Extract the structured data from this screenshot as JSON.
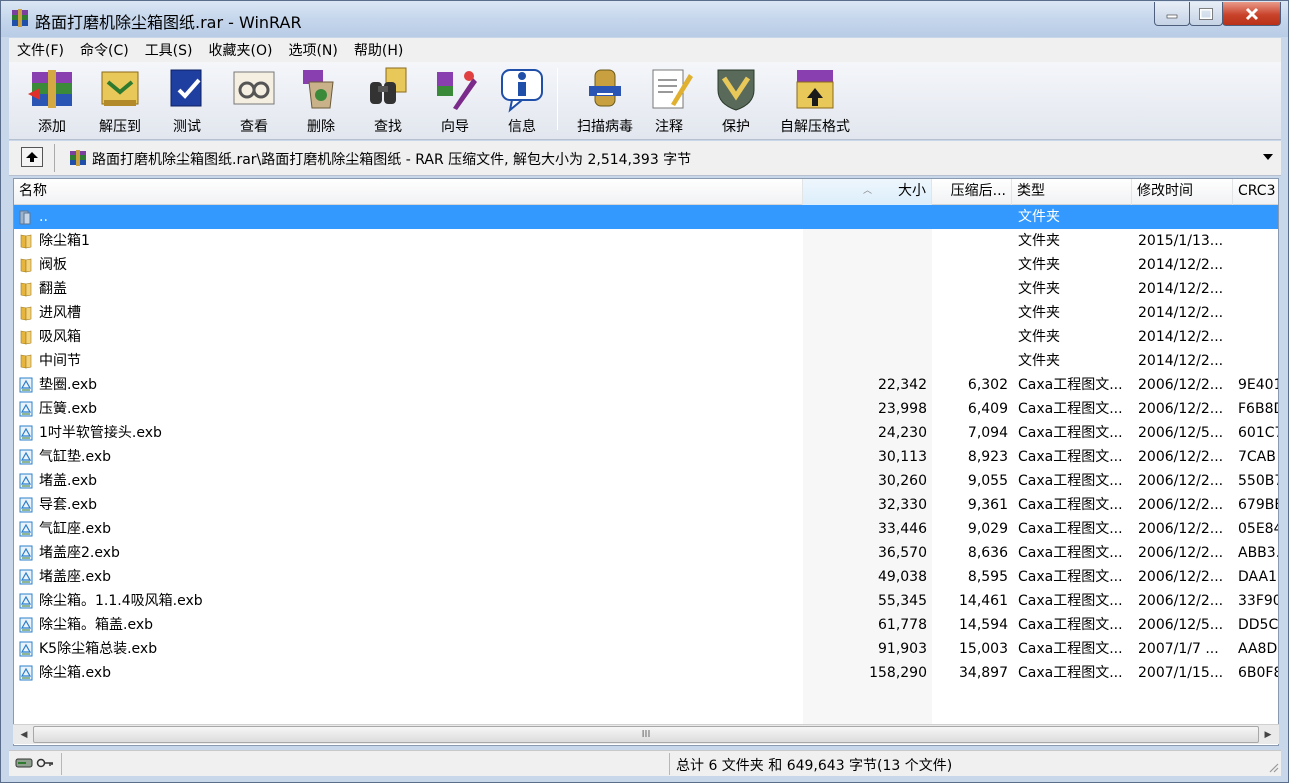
{
  "window": {
    "title": "路面打磨机除尘箱图纸.rar - WinRAR"
  },
  "menu": [
    "文件(F)",
    "命令(C)",
    "工具(S)",
    "收藏夹(O)",
    "选项(N)",
    "帮助(H)"
  ],
  "toolbar": [
    {
      "label": "添加",
      "icon": "add-archive-icon"
    },
    {
      "label": "解压到",
      "icon": "extract-to-icon"
    },
    {
      "label": "测试",
      "icon": "test-icon"
    },
    {
      "label": "查看",
      "icon": "view-icon"
    },
    {
      "label": "删除",
      "icon": "delete-icon"
    },
    {
      "label": "查找",
      "icon": "find-icon"
    },
    {
      "label": "向导",
      "icon": "wizard-icon"
    },
    {
      "label": "信息",
      "icon": "info-icon"
    },
    {
      "label": "扫描病毒",
      "icon": "virus-scan-icon"
    },
    {
      "label": "注释",
      "icon": "comment-icon"
    },
    {
      "label": "保护",
      "icon": "protect-icon"
    },
    {
      "label": "自解压格式",
      "icon": "sfx-icon"
    }
  ],
  "address": {
    "path": "路面打磨机除尘箱图纸.rar\\路面打磨机除尘箱图纸 - RAR 压缩文件, 解包大小为 2,514,393 字节"
  },
  "columns": {
    "name": "名称",
    "size": "大小",
    "packed": "压缩后...",
    "type": "类型",
    "mtime": "修改时间",
    "crc": "CRC3"
  },
  "files": [
    {
      "name": "..",
      "size": "",
      "packed": "",
      "type": "文件夹",
      "mtime": "",
      "crc": "",
      "kind": "parent",
      "selected": true
    },
    {
      "name": "除尘箱1",
      "size": "",
      "packed": "",
      "type": "文件夹",
      "mtime": "2015/1/13...",
      "crc": "",
      "kind": "folder"
    },
    {
      "name": "阀板",
      "size": "",
      "packed": "",
      "type": "文件夹",
      "mtime": "2014/12/2...",
      "crc": "",
      "kind": "folder"
    },
    {
      "name": "翻盖",
      "size": "",
      "packed": "",
      "type": "文件夹",
      "mtime": "2014/12/2...",
      "crc": "",
      "kind": "folder"
    },
    {
      "name": "进风槽",
      "size": "",
      "packed": "",
      "type": "文件夹",
      "mtime": "2014/12/2...",
      "crc": "",
      "kind": "folder"
    },
    {
      "name": "吸风箱",
      "size": "",
      "packed": "",
      "type": "文件夹",
      "mtime": "2014/12/2...",
      "crc": "",
      "kind": "folder"
    },
    {
      "name": "中间节",
      "size": "",
      "packed": "",
      "type": "文件夹",
      "mtime": "2014/12/2...",
      "crc": "",
      "kind": "folder"
    },
    {
      "name": "垫圈.exb",
      "size": "22,342",
      "packed": "6,302",
      "type": "Caxa工程图文...",
      "mtime": "2006/12/2...",
      "crc": "9E401",
      "kind": "file"
    },
    {
      "name": "压簧.exb",
      "size": "23,998",
      "packed": "6,409",
      "type": "Caxa工程图文...",
      "mtime": "2006/12/2...",
      "crc": "F6B8D",
      "kind": "file"
    },
    {
      "name": "1吋半软管接头.exb",
      "size": "24,230",
      "packed": "7,094",
      "type": "Caxa工程图文...",
      "mtime": "2006/12/5...",
      "crc": "601C7",
      "kind": "file"
    },
    {
      "name": "气缸垫.exb",
      "size": "30,113",
      "packed": "8,923",
      "type": "Caxa工程图文...",
      "mtime": "2006/12/2...",
      "crc": "7CAB",
      "kind": "file"
    },
    {
      "name": "堵盖.exb",
      "size": "30,260",
      "packed": "9,055",
      "type": "Caxa工程图文...",
      "mtime": "2006/12/2...",
      "crc": "550B7",
      "kind": "file"
    },
    {
      "name": "导套.exb",
      "size": "32,330",
      "packed": "9,361",
      "type": "Caxa工程图文...",
      "mtime": "2006/12/2...",
      "crc": "679BE",
      "kind": "file"
    },
    {
      "name": "气缸座.exb",
      "size": "33,446",
      "packed": "9,029",
      "type": "Caxa工程图文...",
      "mtime": "2006/12/2...",
      "crc": "05E84",
      "kind": "file"
    },
    {
      "name": "堵盖座2.exb",
      "size": "36,570",
      "packed": "8,636",
      "type": "Caxa工程图文...",
      "mtime": "2006/12/2...",
      "crc": "ABB3.",
      "kind": "file"
    },
    {
      "name": "堵盖座.exb",
      "size": "49,038",
      "packed": "8,595",
      "type": "Caxa工程图文...",
      "mtime": "2006/12/2...",
      "crc": "DAA1",
      "kind": "file"
    },
    {
      "name": "除尘箱。1.1.4吸风箱.exb",
      "size": "55,345",
      "packed": "14,461",
      "type": "Caxa工程图文...",
      "mtime": "2006/12/2...",
      "crc": "33F90",
      "kind": "file"
    },
    {
      "name": "除尘箱。箱盖.exb",
      "size": "61,778",
      "packed": "14,594",
      "type": "Caxa工程图文...",
      "mtime": "2006/12/5...",
      "crc": "DD5C",
      "kind": "file"
    },
    {
      "name": "K5除尘箱总装.exb",
      "size": "91,903",
      "packed": "15,003",
      "type": "Caxa工程图文...",
      "mtime": "2007/1/7 ...",
      "crc": "AA8D",
      "kind": "file"
    },
    {
      "name": "除尘箱.exb",
      "size": "158,290",
      "packed": "34,897",
      "type": "Caxa工程图文...",
      "mtime": "2007/1/15...",
      "crc": "6B0F8",
      "kind": "file"
    }
  ],
  "scrollbar": {
    "grip": "III"
  },
  "status": {
    "text": "总计 6 文件夹 和 649,643 字节(13 个文件)"
  },
  "colors": {
    "selection": "#3399ff",
    "folder": "#e8b53c",
    "file_icon": "#2b7fc9"
  }
}
